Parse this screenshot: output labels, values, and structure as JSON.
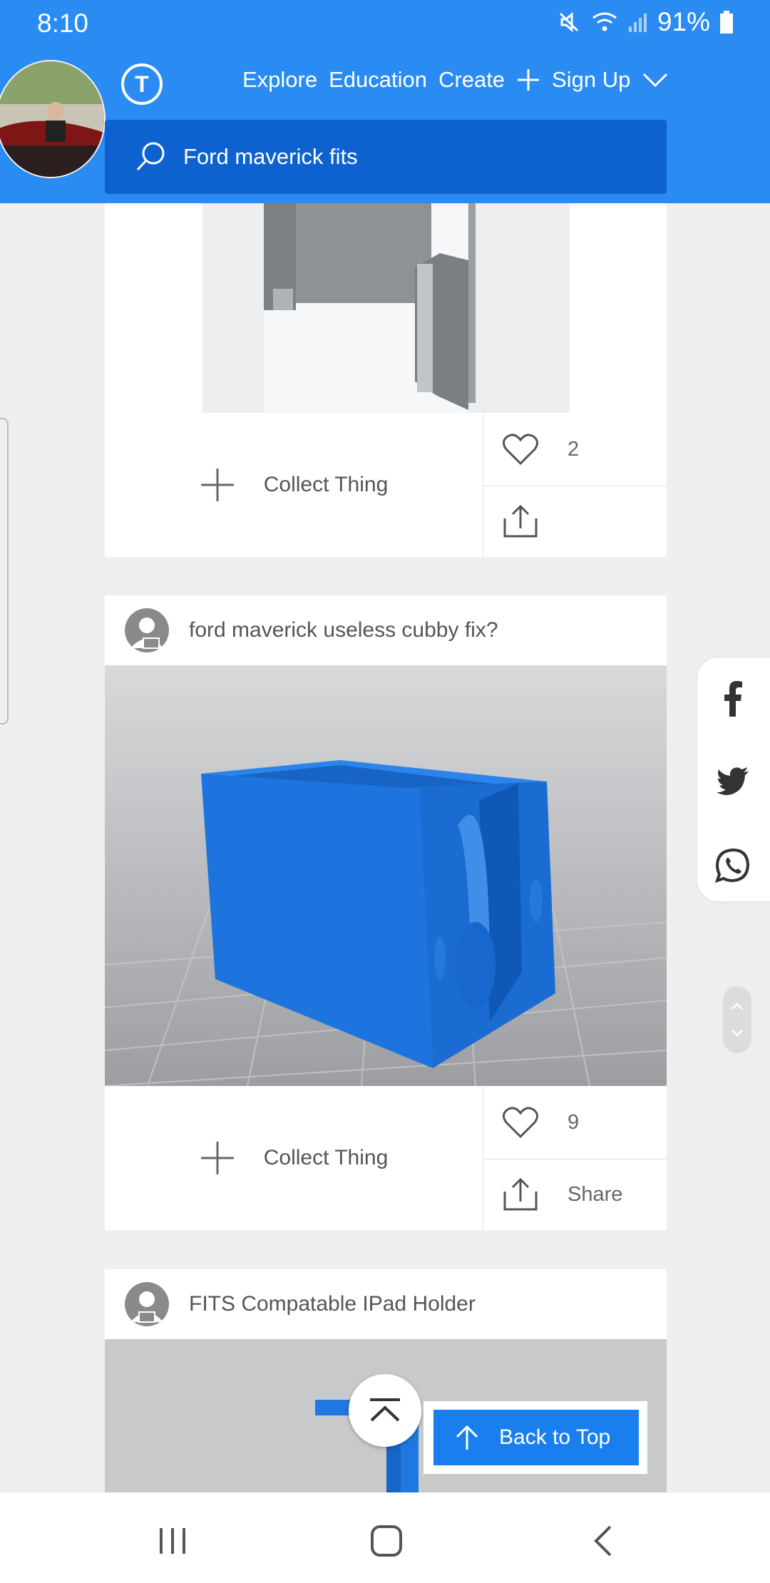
{
  "status_bar": {
    "time": "8:10",
    "battery": "91%",
    "icons": [
      "mute-icon",
      "wifi-icon",
      "signal-icon",
      "battery-icon"
    ]
  },
  "header": {
    "logo_letter": "T",
    "nav": {
      "explore": "Explore",
      "education": "Education",
      "create": "Create",
      "signup": "Sign Up"
    },
    "search_value": "Ford maverick fits"
  },
  "cards": [
    {
      "collect_label": "Collect Thing",
      "likes": "2",
      "share_label": ""
    },
    {
      "title": "ford maverick useless cubby fix?",
      "collect_label": "Collect Thing",
      "likes": "9",
      "share_label": "Share"
    },
    {
      "title": "FITS Compatable IPad Holder"
    }
  ],
  "share_rail": [
    "facebook-icon",
    "twitter-icon",
    "whatsapp-icon"
  ],
  "back_to_top": {
    "label": "Back to Top"
  },
  "colors": {
    "header": "#2a8bf2",
    "search": "#0e62d0",
    "accent": "#1a7fee",
    "model_blue": "#1f78e0"
  }
}
